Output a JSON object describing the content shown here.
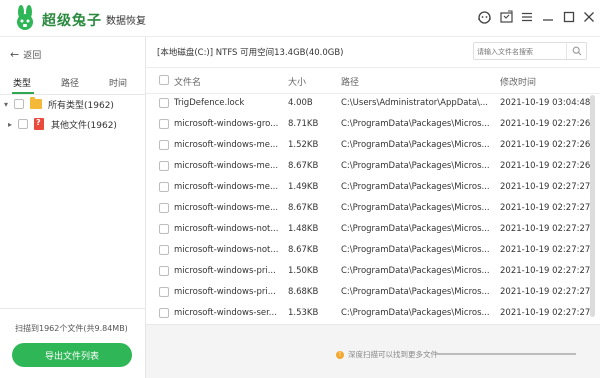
{
  "app": {
    "title": "超级兔子",
    "subtitle": "数据恢复",
    "icons": [
      "support-icon",
      "screenshot-icon",
      "menu-icon",
      "minimize-icon",
      "maximize-icon",
      "close-icon"
    ]
  },
  "left": {
    "back_label": "返回",
    "tabs": [
      "类型",
      "路径",
      "时间"
    ],
    "active_tab": "类型",
    "tree": [
      {
        "label": "所有类型(1962)"
      },
      {
        "label": "其他文件(1962)"
      }
    ],
    "scan_stat": "扫描到1962个文件(共9.84MB)",
    "export_label": "导出文件列表"
  },
  "main": {
    "path_info": "[本地磁盘(C:)] NTFS 可用空间13.4GB(40.0GB)",
    "search_placeholder": "请输入文件名搜索",
    "columns": [
      "文件名",
      "大小",
      "路径",
      "修改时间"
    ],
    "rows": [
      {
        "name": "TrigDefence.lock",
        "size": "4.00B",
        "path": "C:\\Users\\Administrator\\AppData\\...",
        "time": "2021-10-19 03:04:48"
      },
      {
        "name": "microsoft-windows-gro...",
        "size": "8.71KB",
        "path": "C:\\ProgramData\\Packages\\Micros...",
        "time": "2021-10-19 02:27:26"
      },
      {
        "name": "microsoft-windows-me...",
        "size": "1.52KB",
        "path": "C:\\ProgramData\\Packages\\Micros...",
        "time": "2021-10-19 02:27:26"
      },
      {
        "name": "microsoft-windows-me...",
        "size": "8.67KB",
        "path": "C:\\ProgramData\\Packages\\Micros...",
        "time": "2021-10-19 02:27:26"
      },
      {
        "name": "microsoft-windows-me...",
        "size": "1.49KB",
        "path": "C:\\ProgramData\\Packages\\Micros...",
        "time": "2021-10-19 02:27:27"
      },
      {
        "name": "microsoft-windows-me...",
        "size": "8.67KB",
        "path": "C:\\ProgramData\\Packages\\Micros...",
        "time": "2021-10-19 02:27:27"
      },
      {
        "name": "microsoft-windows-not...",
        "size": "1.48KB",
        "path": "C:\\ProgramData\\Packages\\Micros...",
        "time": "2021-10-19 02:27:27"
      },
      {
        "name": "microsoft-windows-not...",
        "size": "8.67KB",
        "path": "C:\\ProgramData\\Packages\\Micros...",
        "time": "2021-10-19 02:27:27"
      },
      {
        "name": "microsoft-windows-pri...",
        "size": "1.50KB",
        "path": "C:\\ProgramData\\Packages\\Micros...",
        "time": "2021-10-19 02:27:27"
      },
      {
        "name": "microsoft-windows-pri...",
        "size": "8.68KB",
        "path": "C:\\ProgramData\\Packages\\Micros...",
        "time": "2021-10-19 02:27:27"
      },
      {
        "name": "microsoft-windows-ser...",
        "size": "1.53KB",
        "path": "C:\\ProgramData\\Packages\\Micros...",
        "time": "2021-10-19 02:27:27"
      }
    ],
    "footer_tip": "深度扫描可以找到更多文件"
  },
  "colors": {
    "brand_green": "#2fb757",
    "title_green": "#2a8a3e",
    "folder_yellow": "#f5b93a",
    "other_file_red": "#e94a3c",
    "tip_orange": "#f0a830"
  }
}
